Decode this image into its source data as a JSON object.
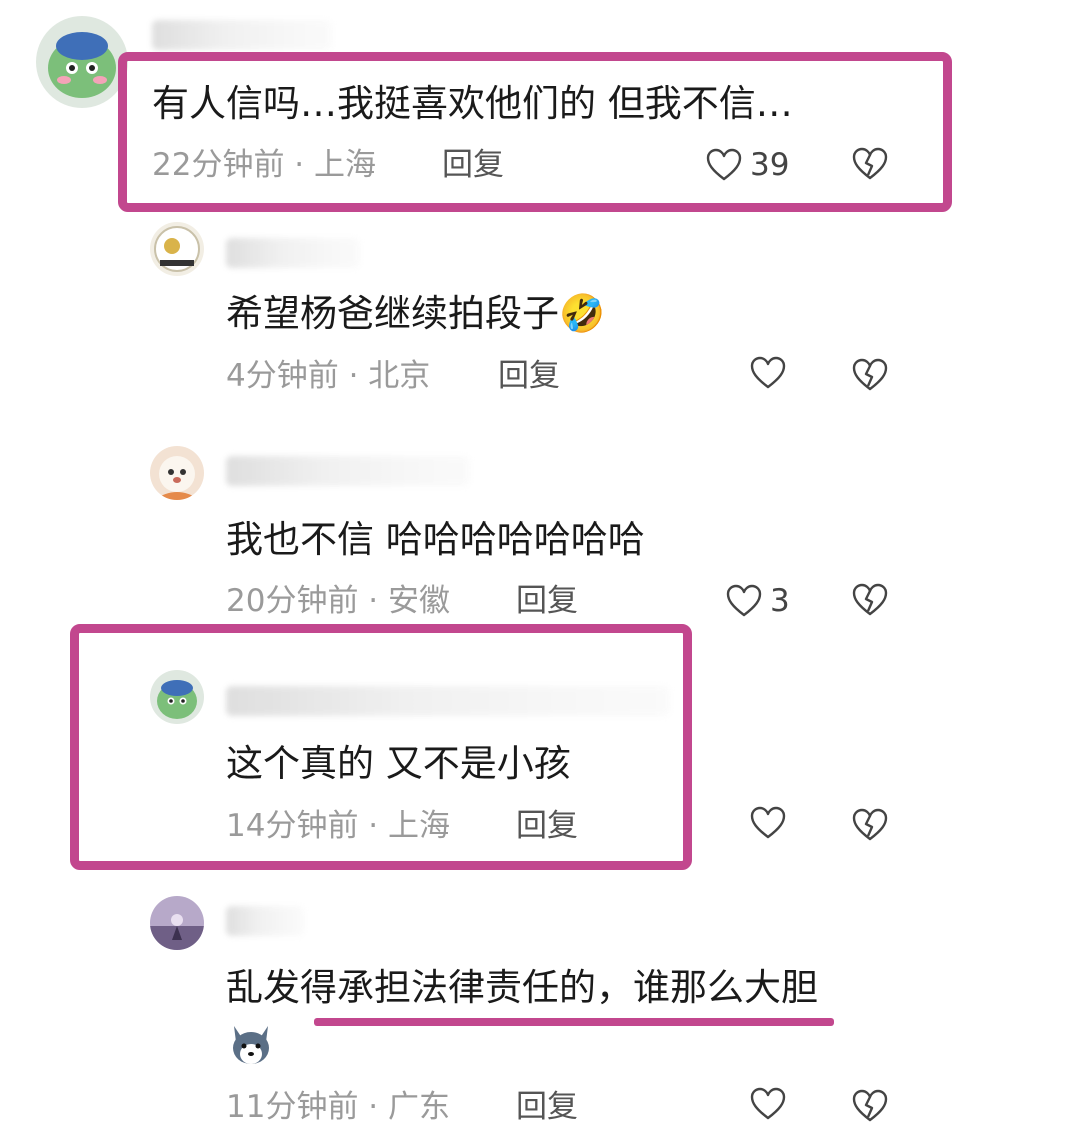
{
  "colors": {
    "highlight": "#c2478e",
    "meta": "#9a9a9a"
  },
  "comments": [
    {
      "text": "有人信吗…我挺喜欢他们的 但我不信…",
      "time_loc": "22分钟前 · 上海",
      "reply": "回复",
      "likes": "39"
    },
    {
      "text": "希望杨爸继续拍段子",
      "emoji": "🤣",
      "time_loc": "4分钟前 · 北京",
      "reply": "回复",
      "likes": ""
    },
    {
      "text": "我也不信  哈哈哈哈哈哈哈",
      "time_loc": "20分钟前 · 安徽",
      "reply": "回复",
      "likes": "3"
    },
    {
      "text": "这个真的 又不是小孩",
      "time_loc": "14分钟前 · 上海",
      "reply": "回复",
      "likes": ""
    },
    {
      "text": "乱发得承担法律责任的，谁那么大胆",
      "time_loc": "11分钟前 · 广东",
      "reply": "回复",
      "likes": ""
    }
  ]
}
